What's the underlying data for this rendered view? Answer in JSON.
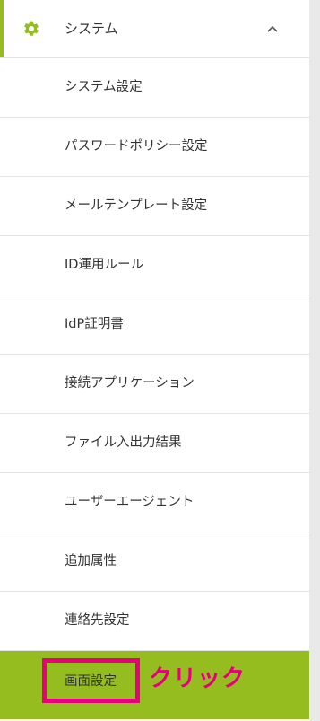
{
  "sidebar": {
    "section_title": "システム",
    "section_icon": "gear-icon",
    "collapse_icon": "chevron-up-icon",
    "accent_color": "#95bd1f",
    "items": [
      {
        "label": "システム設定"
      },
      {
        "label": "パスワードポリシー設定"
      },
      {
        "label": "メールテンプレート設定"
      },
      {
        "label": "ID運用ルール"
      },
      {
        "label": "IdP証明書"
      },
      {
        "label": "接続アプリケーション"
      },
      {
        "label": "ファイル入出力結果"
      },
      {
        "label": "ユーザーエージェント"
      },
      {
        "label": "追加属性"
      },
      {
        "label": "連絡先設定"
      },
      {
        "label": "画面設定",
        "active": true
      }
    ]
  },
  "annotation": {
    "text": "クリック",
    "color": "#e6007e"
  }
}
